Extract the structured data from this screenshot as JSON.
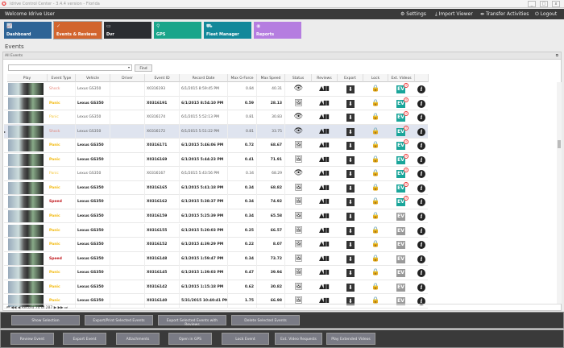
{
  "window": {
    "title": "Idrive Control Center - 3.4.4 version - Florida",
    "minimize": "_",
    "maximize": "□",
    "close": "x"
  },
  "header": {
    "welcome": "Welcome Idrive User",
    "settings": "Settings",
    "import_viewer": "Import Viewer",
    "transfer": "Transfer Activities",
    "logout": "Logout"
  },
  "tiles": [
    {
      "label": "Dashboard",
      "color": "#2e6496"
    },
    {
      "label": "Events & Reviews",
      "color": "#d2652e"
    },
    {
      "label": "Dvr",
      "color": "#2a2d31"
    },
    {
      "label": "GPS",
      "color": "#1aa58a"
    },
    {
      "label": "Fleet Manager",
      "color": "#13889a"
    },
    {
      "label": "Reports",
      "color": "#b57de0"
    }
  ],
  "page_title": "Events",
  "panel": {
    "title": "All Events",
    "search_value": "",
    "find": "Find"
  },
  "columns": [
    "Play",
    "Event Type",
    "Vehicle",
    "Driver",
    "Event ID",
    "Record Date",
    "Max G-Force",
    "Max Speed",
    "Status",
    "Reviews",
    "Export",
    "Lock",
    "Ext. Videos",
    ""
  ],
  "rows": [
    {
      "type": "Shock",
      "vehicle": "Lexus GS350",
      "driver": "",
      "id": "X0316193",
      "date": "6/1/2015 8:59:45 PM",
      "g": "0.84",
      "speed": "40.31",
      "status": "eye",
      "bold": false,
      "ev": "active"
    },
    {
      "type": "Panic",
      "vehicle": "Lexus GS350",
      "driver": "",
      "id": "X0316191",
      "date": "6/1/2015 8:54:10 PM",
      "g": "0.59",
      "speed": "28.13",
      "status": "image",
      "bold": true,
      "ev": "active"
    },
    {
      "type": "Panic",
      "vehicle": "Lexus GS350",
      "driver": "",
      "id": "X0316174",
      "date": "6/1/2015 5:52:13 PM",
      "g": "0.81",
      "speed": "30.83",
      "status": "eye",
      "bold": false,
      "ev": "active"
    },
    {
      "type": "Shock",
      "vehicle": "Lexus GS350",
      "driver": "",
      "id": "X0316172",
      "date": "6/1/2015 5:51:22 PM",
      "g": "0.81",
      "speed": "33.75",
      "status": "eye",
      "bold": false,
      "ev": "active",
      "selected": true
    },
    {
      "type": "Panic",
      "vehicle": "Lexus GS350",
      "driver": "",
      "id": "X0316171",
      "date": "6/1/2015 5:46:06 PM",
      "g": "0.72",
      "speed": "68.67",
      "status": "image",
      "bold": true,
      "ev": "active"
    },
    {
      "type": "Panic",
      "vehicle": "Lexus GS350",
      "driver": "",
      "id": "X0316169",
      "date": "6/1/2015 5:44:23 PM",
      "g": "0.41",
      "speed": "71.91",
      "status": "image",
      "bold": true,
      "ev": "active"
    },
    {
      "type": "Panic",
      "vehicle": "Lexus GS350",
      "driver": "",
      "id": "X0316167",
      "date": "6/1/2015 5:43:56 PM",
      "g": "0.34",
      "speed": "68.29",
      "status": "eye",
      "bold": false,
      "ev": "active"
    },
    {
      "type": "Panic",
      "vehicle": "Lexus GS350",
      "driver": "",
      "id": "X0316165",
      "date": "6/1/2015 5:41:18 PM",
      "g": "0.34",
      "speed": "68.82",
      "status": "image",
      "bold": true,
      "ev": "active"
    },
    {
      "type": "Speed",
      "vehicle": "Lexus GS350",
      "driver": "",
      "id": "X0316162",
      "date": "6/1/2015 5:38:37 PM",
      "g": "0.34",
      "speed": "74.92",
      "status": "image",
      "bold": true,
      "ev": "active"
    },
    {
      "type": "Panic",
      "vehicle": "Lexus GS350",
      "driver": "",
      "id": "X0316159",
      "date": "6/1/2015 5:25:39 PM",
      "g": "0.34",
      "speed": "65.58",
      "status": "image",
      "bold": true,
      "ev": "inactive"
    },
    {
      "type": "Panic",
      "vehicle": "Lexus GS350",
      "driver": "",
      "id": "X0316155",
      "date": "6/1/2015 5:20:03 PM",
      "g": "0.25",
      "speed": "66.57",
      "status": "image",
      "bold": true,
      "ev": "inactive"
    },
    {
      "type": "Panic",
      "vehicle": "Lexus GS350",
      "driver": "",
      "id": "X0316152",
      "date": "6/1/2015 4:39:29 PM",
      "g": "0.22",
      "speed": "8.07",
      "status": "image",
      "bold": true,
      "ev": "inactive"
    },
    {
      "type": "Speed",
      "vehicle": "Lexus GS350",
      "driver": "",
      "id": "X0316148",
      "date": "6/1/2015 1:59:47 PM",
      "g": "0.34",
      "speed": "73.72",
      "status": "image",
      "bold": true,
      "ev": "inactive"
    },
    {
      "type": "Panic",
      "vehicle": "Lexus GS350",
      "driver": "",
      "id": "X0316145",
      "date": "6/1/2015 1:39:03 PM",
      "g": "0.47",
      "speed": "39.94",
      "status": "image",
      "bold": true,
      "ev": "inactive"
    },
    {
      "type": "Panic",
      "vehicle": "Lexus GS350",
      "driver": "",
      "id": "X0316142",
      "date": "6/1/2015 1:15:18 PM",
      "g": "0.62",
      "speed": "30.82",
      "status": "image",
      "bold": true,
      "ev": "inactive"
    },
    {
      "type": "Panic",
      "vehicle": "Lexus GS350",
      "driver": "",
      "id": "X0316140",
      "date": "5/31/2015 10:40:41 PM",
      "g": "1.75",
      "speed": "66.98",
      "status": "image",
      "bold": true,
      "ev": "inactive"
    }
  ],
  "type_colors": {
    "Shock": "#e36a5a",
    "Panic": "#f2b705",
    "Speed": "#c0161b"
  },
  "ev_label": "EV",
  "ev_badge": "!",
  "ev_colors": {
    "active": "#1aa59a",
    "inactive": "#9a9a9a"
  },
  "navigator": {
    "record_text": "Record 74 of 287",
    "first": "⏮",
    "prev_page": "◀◀",
    "prev": "◀",
    "next": "▶",
    "next_page": "▶▶",
    "last": "⏭"
  },
  "selection_buttons": [
    "Show Selection",
    "Export/Print Selected Events",
    "Export Selected Events with Reviews",
    "Delete Selected  Events"
  ],
  "event_buttons": [
    "Review Event",
    "Export Event",
    "Attachments",
    "Open in GPS",
    "Lock Event",
    "Ext. Video Requests",
    "Play Extended Videos"
  ]
}
